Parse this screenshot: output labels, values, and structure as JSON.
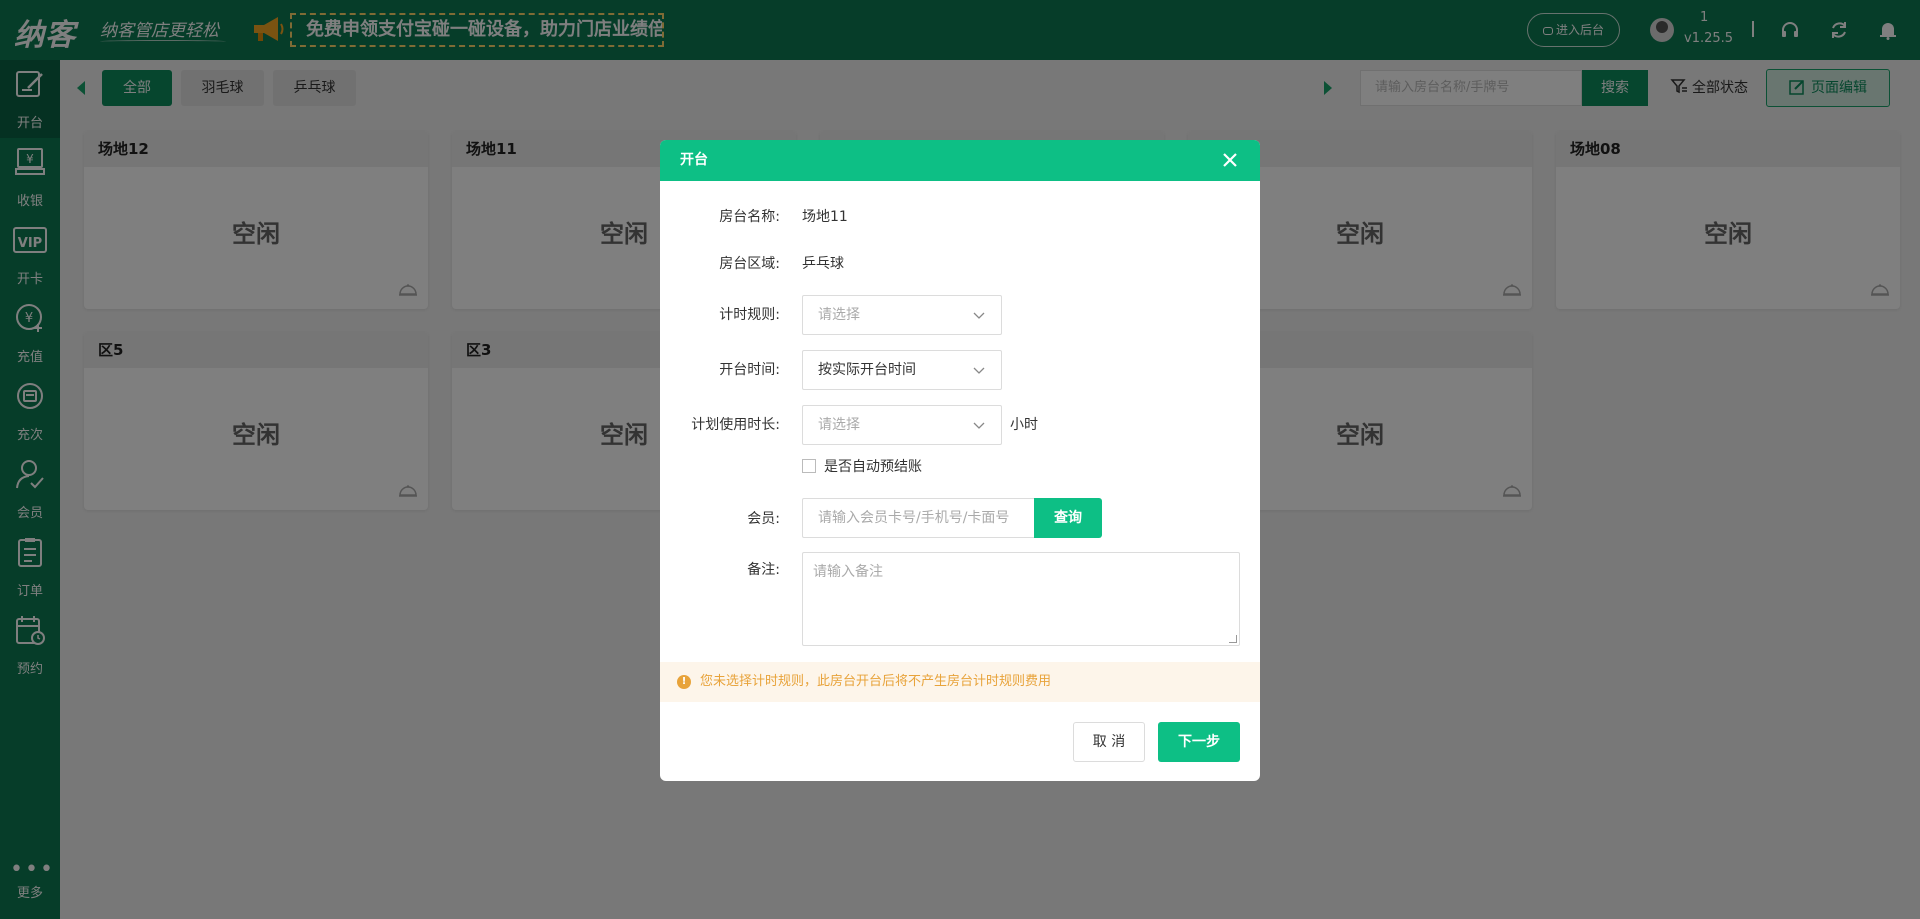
{
  "header": {
    "logo": "纳客",
    "slogan": "纳客管店更轻松",
    "promo": "免费申领支付宝碰一碰设备，助力门店业绩倍增！",
    "enter_backend": "进入后台",
    "user_number": "1",
    "version": "v1.25.5",
    "icons": [
      "headset-icon",
      "refresh-icon",
      "bell-icon"
    ]
  },
  "sidebar": {
    "items": [
      {
        "label": "开台",
        "icon": "table-edit-icon"
      },
      {
        "label": "收银",
        "icon": "cashier-icon"
      },
      {
        "label": "开卡",
        "icon": "vip-card-icon"
      },
      {
        "label": "充值",
        "icon": "recharge-icon"
      },
      {
        "label": "充次",
        "icon": "count-recharge-icon"
      },
      {
        "label": "会员",
        "icon": "member-icon"
      },
      {
        "label": "订单",
        "icon": "order-icon"
      },
      {
        "label": "预约",
        "icon": "reservation-icon"
      }
    ],
    "more_label": "更多"
  },
  "filter": {
    "tabs": [
      "全部",
      "羽毛球",
      "乒乓球"
    ],
    "active_tab": "全部",
    "search_placeholder": "请输入房台名称/手牌号",
    "search_button": "搜索",
    "status_filter": "全部状态",
    "edit_button": "页面编辑"
  },
  "rooms": {
    "row1": [
      {
        "name": "场地12",
        "status": "空闲"
      },
      {
        "name": "场地11",
        "status": "空闲"
      },
      {
        "name": "",
        "status": ""
      },
      {
        "name": "",
        "status": "空闲"
      },
      {
        "name": "场地08",
        "status": "空闲"
      }
    ],
    "row2": [
      {
        "name": "区5",
        "status": "空闲"
      },
      {
        "name": "区3",
        "status": "空闲"
      },
      {
        "name": "",
        "status": ""
      },
      {
        "name": "",
        "status": "空闲"
      }
    ]
  },
  "modal": {
    "title": "开台",
    "room_name_label": "房台名称:",
    "room_name": "场地11",
    "room_area_label": "房台区域:",
    "room_area": "乒乓球",
    "timing_rule_label": "计时规则:",
    "timing_rule_placeholder": "请选择",
    "open_time_label": "开台时间:",
    "open_time_value": "按实际开台时间",
    "planned_duration_label": "计划使用时长:",
    "planned_duration_placeholder": "请选择",
    "duration_unit": "小时",
    "auto_presettle_label": "是否自动预结账",
    "auto_presettle_checked": false,
    "member_label": "会员:",
    "member_placeholder": "请输入会员卡号/手机号/卡面号",
    "query_button": "查询",
    "remark_label": "备注:",
    "remark_placeholder": "请输入备注",
    "warning": "您未选择计时规则，此房台开台后将不产生房台计时规则费用",
    "cancel_button": "取 消",
    "next_button": "下一步"
  },
  "colors": {
    "brand_dark": "#0d7a52",
    "brand": "#0dbf85",
    "warning": "#e8a33a"
  }
}
